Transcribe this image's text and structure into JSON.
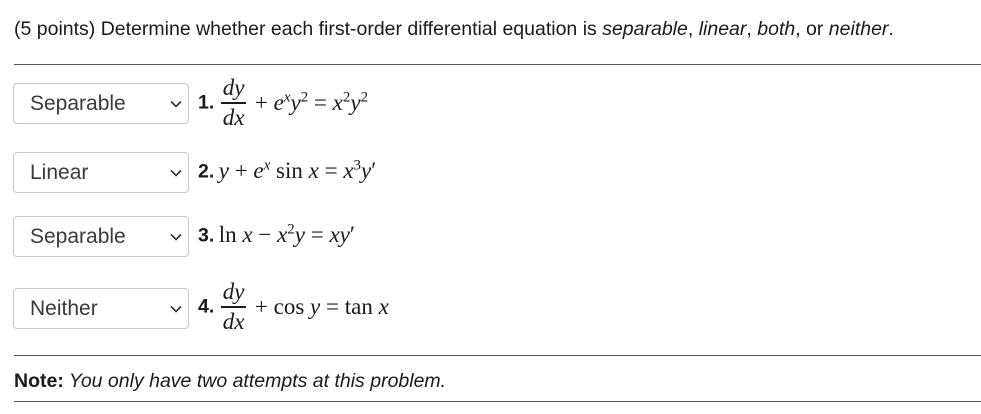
{
  "prompt": {
    "points": "(5 points)",
    "text_before": " Determine whether each first-order differential equation is ",
    "opt1": "separable",
    "sep1": ", ",
    "opt2": "linear",
    "sep2": ", ",
    "opt3": "both",
    "sep3": ", or ",
    "opt4": "neither",
    "end": "."
  },
  "problems": [
    {
      "number": "1.",
      "answer": "Separable",
      "lhs_num": "dy",
      "lhs_den": "dx",
      "rhs": "+ e^x y^2 = x^2 y^2"
    },
    {
      "number": "2.",
      "answer": "Linear",
      "equation": "y + e^x sin x = x^3 y'"
    },
    {
      "number": "3.",
      "answer": "Separable",
      "equation": "ln x − x^2 y = xy'"
    },
    {
      "number": "4.",
      "answer": "Neither",
      "lhs_num": "dy",
      "lhs_den": "dx",
      "rhs": "+ cos y = tan x"
    }
  ],
  "note": {
    "label": "Note:",
    "text": " You only have two attempts at this problem."
  }
}
